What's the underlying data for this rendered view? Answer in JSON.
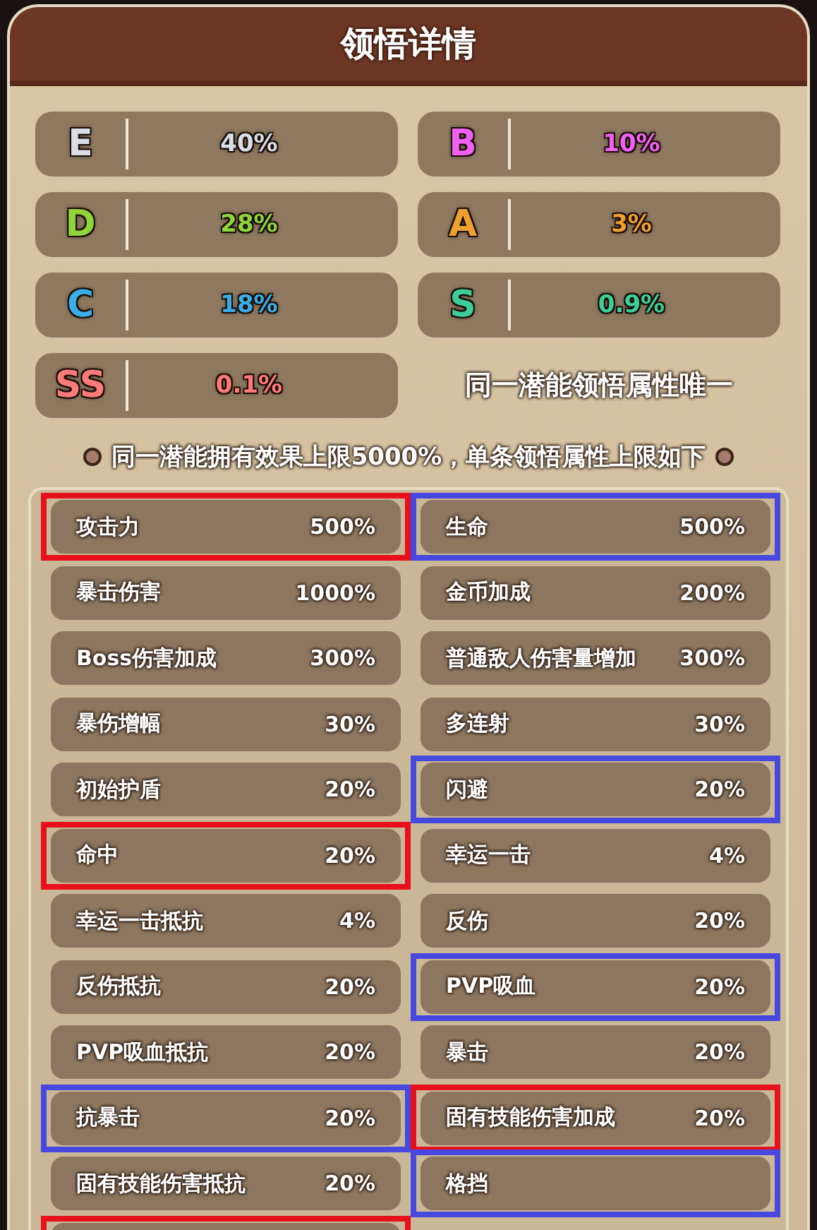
{
  "title": "领悟详情",
  "grades": [
    {
      "grade": "E",
      "chance": "40%",
      "color": "#d8dde6"
    },
    {
      "grade": "B",
      "chance": "10%",
      "color": "#f060f4"
    },
    {
      "grade": "D",
      "chance": "28%",
      "color": "#8fd43a"
    },
    {
      "grade": "A",
      "chance": "3%",
      "color": "#f0a030"
    },
    {
      "grade": "C",
      "chance": "18%",
      "color": "#3aaee8"
    },
    {
      "grade": "S",
      "chance": "0.9%",
      "color": "#3ccf9a"
    },
    {
      "grade": "SS",
      "chance": "0.1%",
      "color": "#ff7a7a"
    }
  ],
  "grade_note": "同一潜能领悟属性唯一",
  "limit_note": "同一潜能拥有效果上限5000%，单条领悟属性上限如下",
  "attributes": [
    {
      "name": "攻击力",
      "limit": "500%",
      "highlighted": true,
      "color": "#e8101a"
    },
    {
      "name": "生命",
      "limit": "500%",
      "highlighted": true,
      "color": "#4848e0"
    },
    {
      "name": "暴击伤害",
      "limit": "1000%",
      "highlighted": false
    },
    {
      "name": "金币加成",
      "limit": "200%",
      "highlighted": false
    },
    {
      "name": "Boss伤害加成",
      "limit": "300%",
      "highlighted": false
    },
    {
      "name": "普通敌人伤害量增加",
      "limit": "300%",
      "highlighted": false
    },
    {
      "name": "暴伤增幅",
      "limit": "30%",
      "highlighted": false
    },
    {
      "name": "多连射",
      "limit": "30%",
      "highlighted": false
    },
    {
      "name": "初始护盾",
      "limit": "20%",
      "highlighted": false
    },
    {
      "name": "闪避",
      "limit": "20%",
      "highlighted": true,
      "color": "#4848e0"
    },
    {
      "name": "命中",
      "limit": "20%",
      "highlighted": true,
      "color": "#e8101a"
    },
    {
      "name": "幸运一击",
      "limit": "4%",
      "highlighted": false
    },
    {
      "name": "幸运一击抵抗",
      "limit": "4%",
      "highlighted": false
    },
    {
      "name": "反伤",
      "limit": "20%",
      "highlighted": false
    },
    {
      "name": "反伤抵抗",
      "limit": "20%",
      "highlighted": false
    },
    {
      "name": "PVP吸血",
      "limit": "20%",
      "highlighted": true,
      "color": "#4848e0"
    },
    {
      "name": "PVP吸血抵抗",
      "limit": "20%",
      "highlighted": false
    },
    {
      "name": "暴击",
      "limit": "20%",
      "highlighted": false
    },
    {
      "name": "抗暴击",
      "limit": "20%",
      "highlighted": true,
      "color": "#4848e0"
    },
    {
      "name": "固有技能伤害加成",
      "limit": "20%",
      "highlighted": true,
      "color": "#e8101a"
    },
    {
      "name": "固有技能伤害抵抗",
      "limit": "20%",
      "highlighted": false
    },
    {
      "name": "格挡",
      "highlighted": true,
      "color": "#4848e0"
    },
    {
      "highlighted": true,
      "color": "#e8101a"
    }
  ]
}
